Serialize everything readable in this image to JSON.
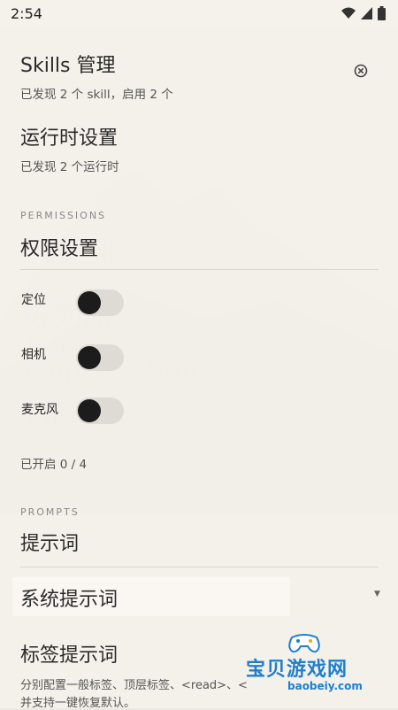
{
  "status_bar": {
    "time": "2:54"
  },
  "skills": {
    "title": "Skills 管理",
    "subtitle": "已发现 2 个 skill，启用 2 个"
  },
  "runtime": {
    "title": "运行时设置",
    "subtitle": "已发现 2 个运行时"
  },
  "permissions": {
    "section_label": "PERMISSIONS",
    "title": "权限设置",
    "items": [
      {
        "label": "定位",
        "enabled": false
      },
      {
        "label": "相机",
        "enabled": false
      },
      {
        "label": "麦克风",
        "enabled": false
      }
    ],
    "summary": "已开启 0 / 4"
  },
  "prompts": {
    "section_label": "PROMPTS",
    "title": "提示词",
    "system_prompt_title": "系统提示词",
    "tag_prompt_title": "标签提示词",
    "tag_prompt_desc_line1": "分别配置一般标签、顶层标签、<read>、<",
    "tag_prompt_desc_line2": "并支持一键恢复默认。"
  },
  "watermark": {
    "text": "宝贝游戏网",
    "url": "baobeiy.com"
  },
  "colors": {
    "accent": "#1c1c1c",
    "toggle_track": "#dedbd5",
    "watermark": "#1e7fd0"
  }
}
